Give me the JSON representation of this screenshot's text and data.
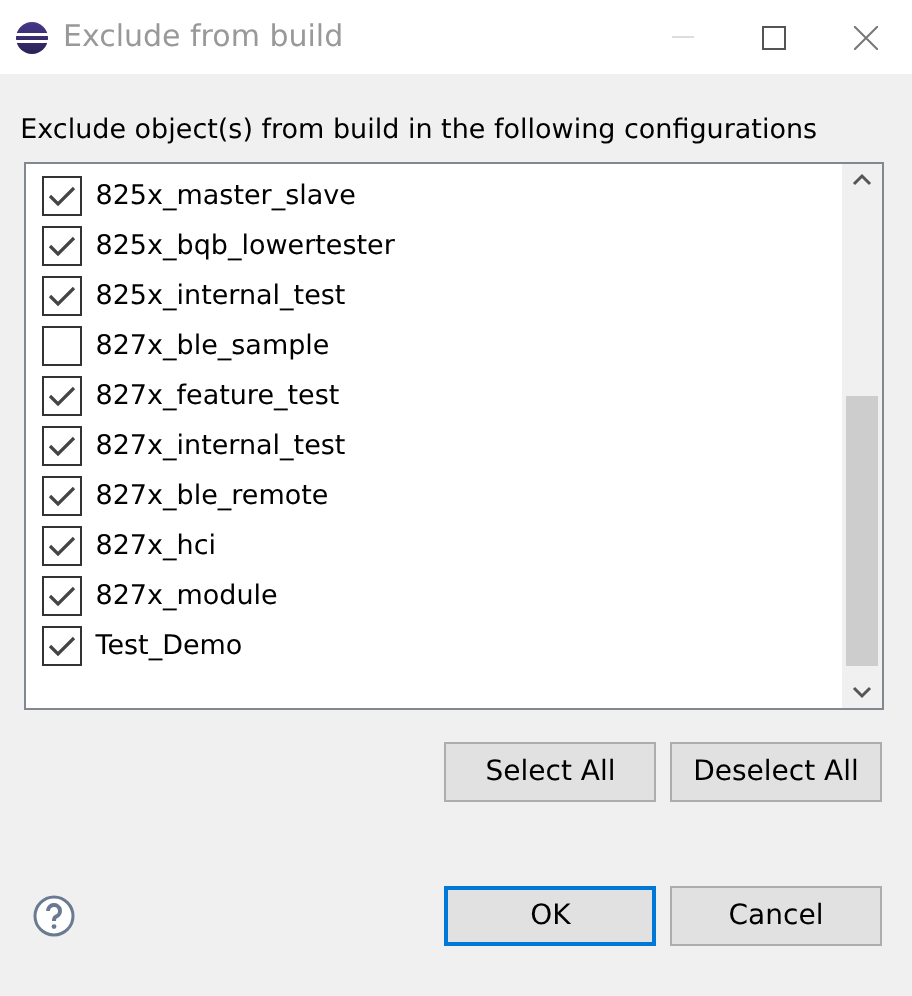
{
  "window": {
    "title": "Exclude from build"
  },
  "instruction": "Exclude object(s) from build in the following configurations",
  "configurations": [
    {
      "name": "825x_master_slave",
      "checked": true
    },
    {
      "name": "825x_bqb_lowertester",
      "checked": true
    },
    {
      "name": "825x_internal_test",
      "checked": true
    },
    {
      "name": "827x_ble_sample",
      "checked": false
    },
    {
      "name": "827x_feature_test",
      "checked": true
    },
    {
      "name": "827x_internal_test",
      "checked": true
    },
    {
      "name": "827x_ble_remote",
      "checked": true
    },
    {
      "name": "827x_hci",
      "checked": true
    },
    {
      "name": "827x_module",
      "checked": true
    },
    {
      "name": "Test_Demo",
      "checked": true
    }
  ],
  "selection_buttons": [
    "Select All",
    "Deselect All"
  ],
  "footer_buttons": [
    {
      "label": "OK",
      "default": true
    },
    {
      "label": "Cancel",
      "default": false
    }
  ]
}
